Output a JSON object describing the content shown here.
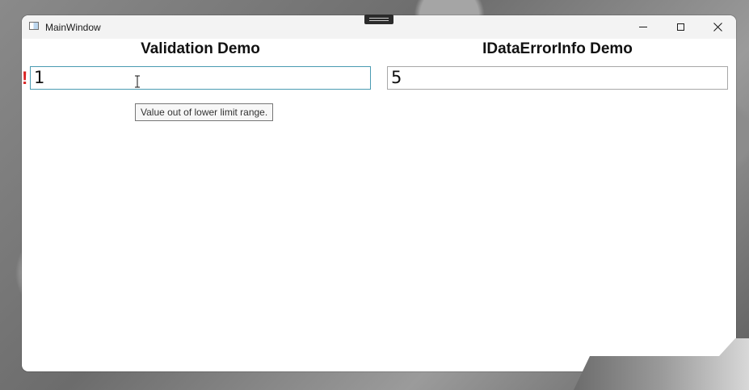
{
  "window": {
    "title": "MainWindow"
  },
  "icons": {
    "app": "app-window-icon",
    "minimize": "minimize-icon",
    "maximize": "maximize-icon",
    "close": "close-icon",
    "error": "error-exclamation-icon",
    "cursor": "text-cursor-icon",
    "drag": "drag-handle-icon"
  },
  "validation": {
    "title": "Validation Demo",
    "value": "1",
    "error_mark": "!",
    "tooltip": "Value out of lower limit range."
  },
  "idataerror": {
    "title": "IDataErrorInfo Demo",
    "value": "5"
  },
  "colors": {
    "focus_border": "#4a9bb2",
    "error": "#d92020",
    "titlebar": "#f3f3f3"
  }
}
